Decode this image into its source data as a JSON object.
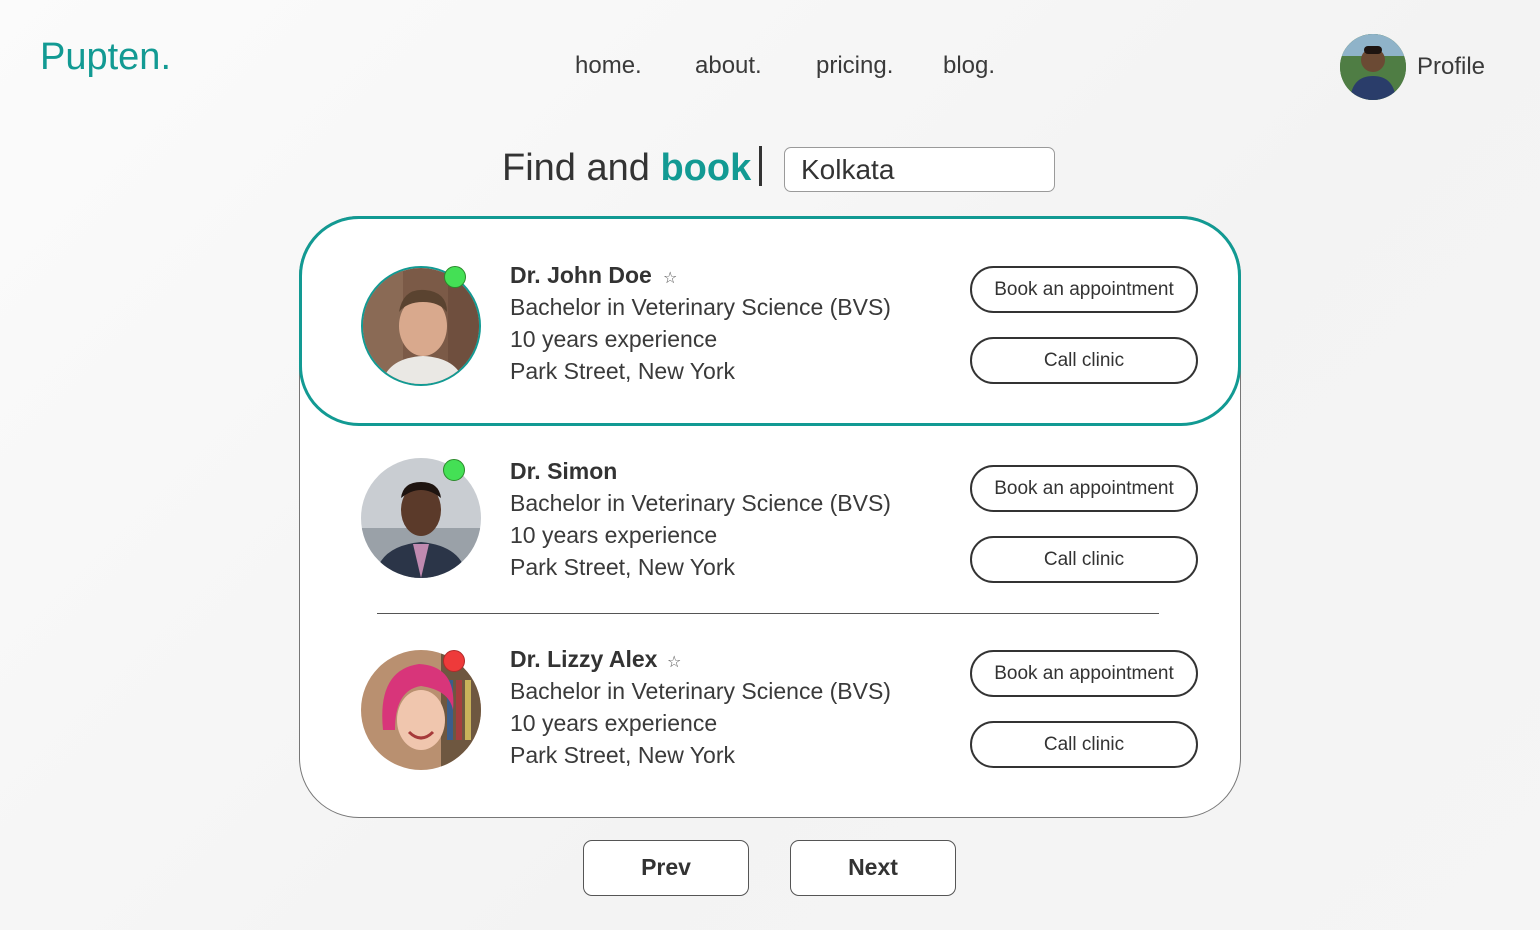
{
  "brand": {
    "name": "Pupten."
  },
  "nav": {
    "items": [
      {
        "label": "home."
      },
      {
        "label": "about."
      },
      {
        "label": "pricing."
      },
      {
        "label": "blog."
      }
    ]
  },
  "profile": {
    "label": "Profile"
  },
  "search": {
    "prefix": "Find and ",
    "accent": "book",
    "value": "Kolkata"
  },
  "doctors": [
    {
      "name": "Dr. John Doe",
      "starred": true,
      "status": "online",
      "status_color": "#44e055",
      "degree": "Bachelor in Veterinary Science (BVS)",
      "experience": "10 years experience",
      "location": "Park Street, New York",
      "book_label": "Book an appointment",
      "call_label": "Call clinic",
      "highlighted": true
    },
    {
      "name": "Dr. Simon",
      "starred": false,
      "status": "online",
      "status_color": "#44e055",
      "degree": "Bachelor in Veterinary Science (BVS)",
      "experience": "10 years experience",
      "location": "Park Street, New York",
      "book_label": "Book an appointment",
      "call_label": "Call clinic",
      "highlighted": false
    },
    {
      "name": "Dr. Lizzy Alex",
      "starred": true,
      "status": "offline",
      "status_color": "#ee3a3a",
      "degree": "Bachelor in Veterinary Science (BVS)",
      "experience": "10 years experience",
      "location": "Park Street, New York",
      "book_label": "Book an appointment",
      "call_label": "Call clinic",
      "highlighted": false
    }
  ],
  "pagination": {
    "prev_label": "Prev",
    "next_label": "Next"
  },
  "colors": {
    "accent": "#129a93"
  }
}
